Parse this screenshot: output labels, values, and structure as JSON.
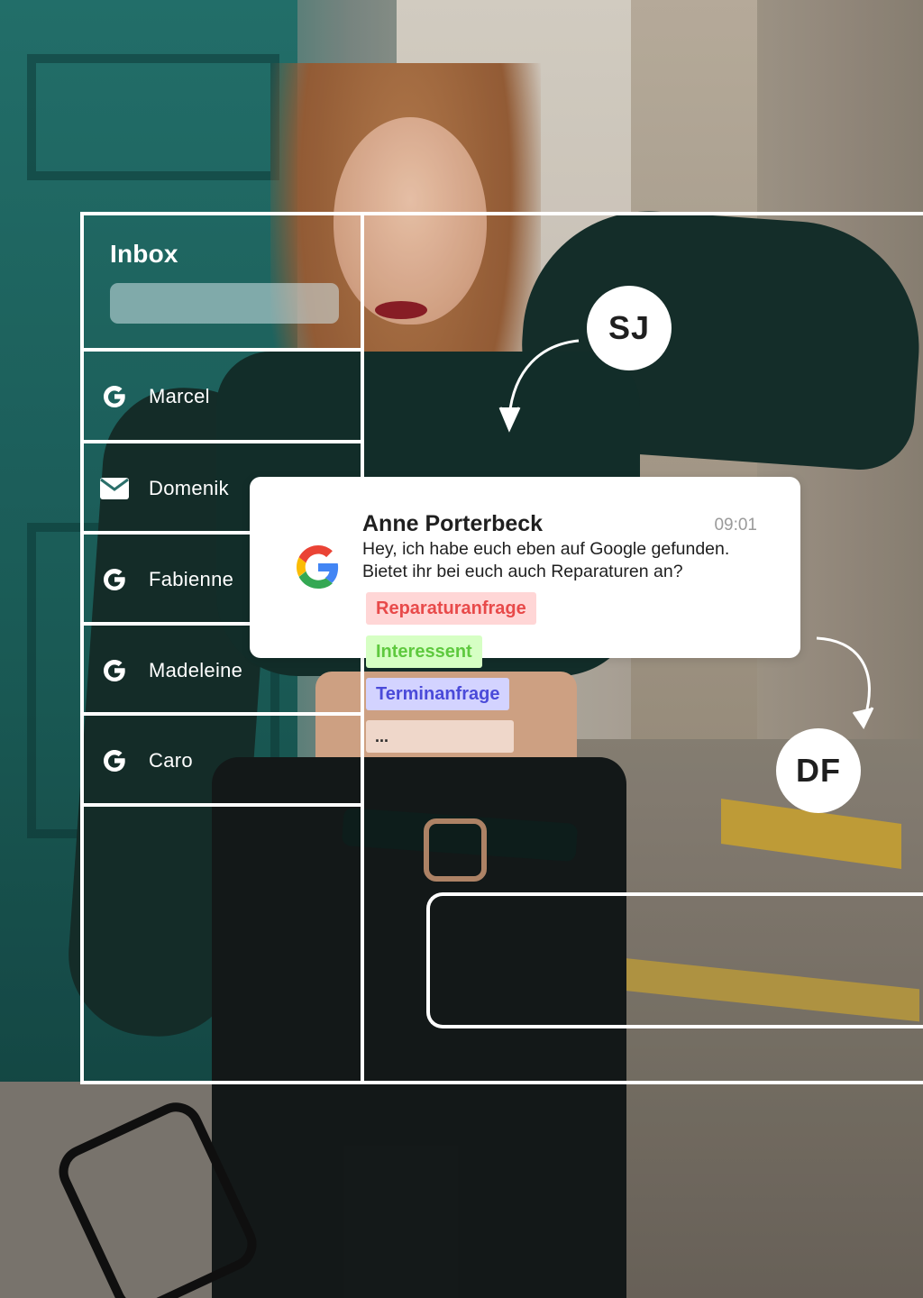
{
  "inbox": {
    "title": "Inbox",
    "contacts": [
      {
        "name": "Marcel",
        "icon": "google-g-icon"
      },
      {
        "name": "Domenik",
        "icon": "envelope-icon"
      },
      {
        "name": "Fabienne",
        "icon": "google-g-icon"
      },
      {
        "name": "Madeleine",
        "icon": "google-g-icon"
      },
      {
        "name": "Caro",
        "icon": "google-g-icon"
      }
    ]
  },
  "message": {
    "sender": "Anne Porterbeck",
    "time": "09:01",
    "text_line1": "Hey, ich habe euch eben auf Google gefunden.",
    "text_line2": "Bietet ihr bei euch auch Reparaturen an?",
    "source_icon": "google-logo-icon"
  },
  "tags": [
    {
      "label": "Reparaturanfrage",
      "color": "#e84a4a",
      "bg": "#ffd6d6"
    },
    {
      "label": "Interessent",
      "color": "#5ec93e",
      "bg": "#d6ffc4"
    },
    {
      "label": "Terminanfrage",
      "color": "#4a4ad9",
      "bg": "#d3d3ff"
    },
    {
      "label": "...",
      "color": "#2a2a2a",
      "bg": "#f5e1d7"
    }
  ],
  "avatars": {
    "top": "SJ",
    "bottom": "DF"
  },
  "colors": {
    "overlay_lines": "#ffffff",
    "card": "#ffffff"
  }
}
